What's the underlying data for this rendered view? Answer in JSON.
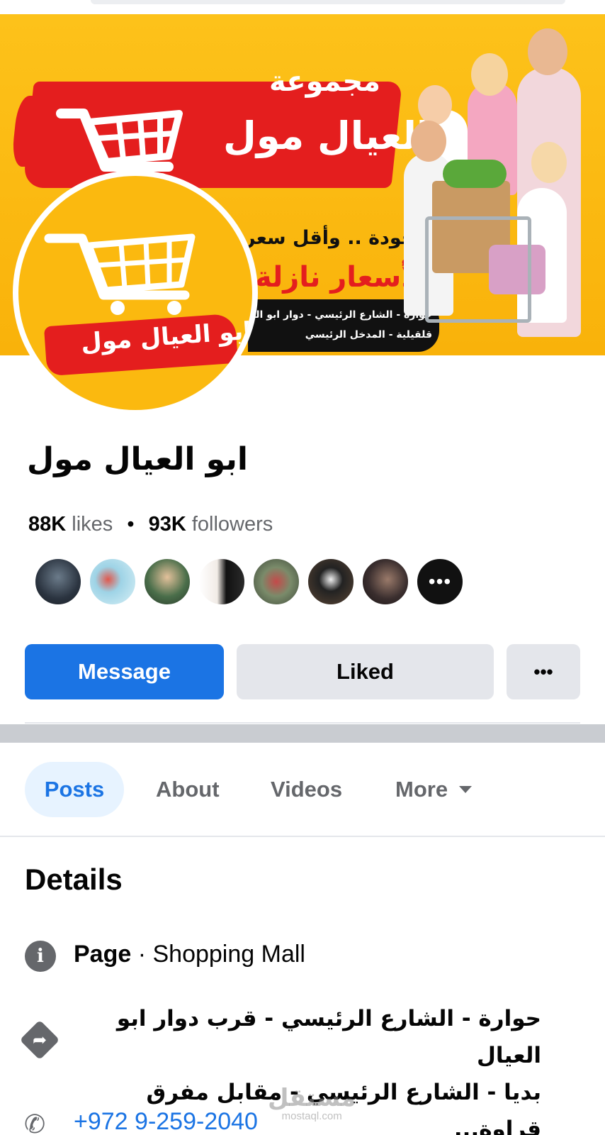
{
  "cover": {
    "group_label": "مجموعة",
    "title": "ابو العيال مول",
    "bullet": "اكثر جودة .. وأقل سعر",
    "prices": "بالأسعار نازلة",
    "address_line_1": "حوارة - الشارع الرئيسي - دوار ابو العيال",
    "address_line_2": "قلقيلية - المدخل الرئيسي"
  },
  "profile": {
    "name_on_logo": "ابو العيال مول"
  },
  "page": {
    "name": "ابو العيال مول",
    "likes_count": "88K",
    "likes_label": "likes",
    "separator": "•",
    "followers_count": "93K",
    "followers_label": "followers",
    "friends_more": "•••"
  },
  "actions": {
    "message": "Message",
    "liked": "Liked",
    "more": "•••"
  },
  "tabs": [
    {
      "label": "Posts",
      "active": true
    },
    {
      "label": "About",
      "active": false
    },
    {
      "label": "Videos",
      "active": false
    },
    {
      "label": "More",
      "active": false
    }
  ],
  "details": {
    "title": "Details",
    "info_icon": "i",
    "category_label": "Page",
    "category_sep": " · ",
    "category_value": "Shopping Mall",
    "address_line_1": "حوارة - الشارع الرئيسي - قرب دوار ابو العيال",
    "address_line_2": "بديا - الشارع الرئيسي - مقابل مفرق قراوة...",
    "phone": "+972 9-259-2040"
  },
  "watermark": {
    "arabic": "مستقل",
    "latin": "mostaql.com"
  },
  "colors": {
    "brand_yellow": "#fbb90f",
    "brand_red": "#e41e1e",
    "facebook_blue": "#1b74e4",
    "button_grey": "#e4e6eb",
    "muted_text": "#65676b"
  },
  "icons": {
    "info": "info-icon",
    "directions": "directions-icon",
    "phone": "phone-icon",
    "caret": "caret-down-icon",
    "cart": "shopping-cart-icon"
  }
}
